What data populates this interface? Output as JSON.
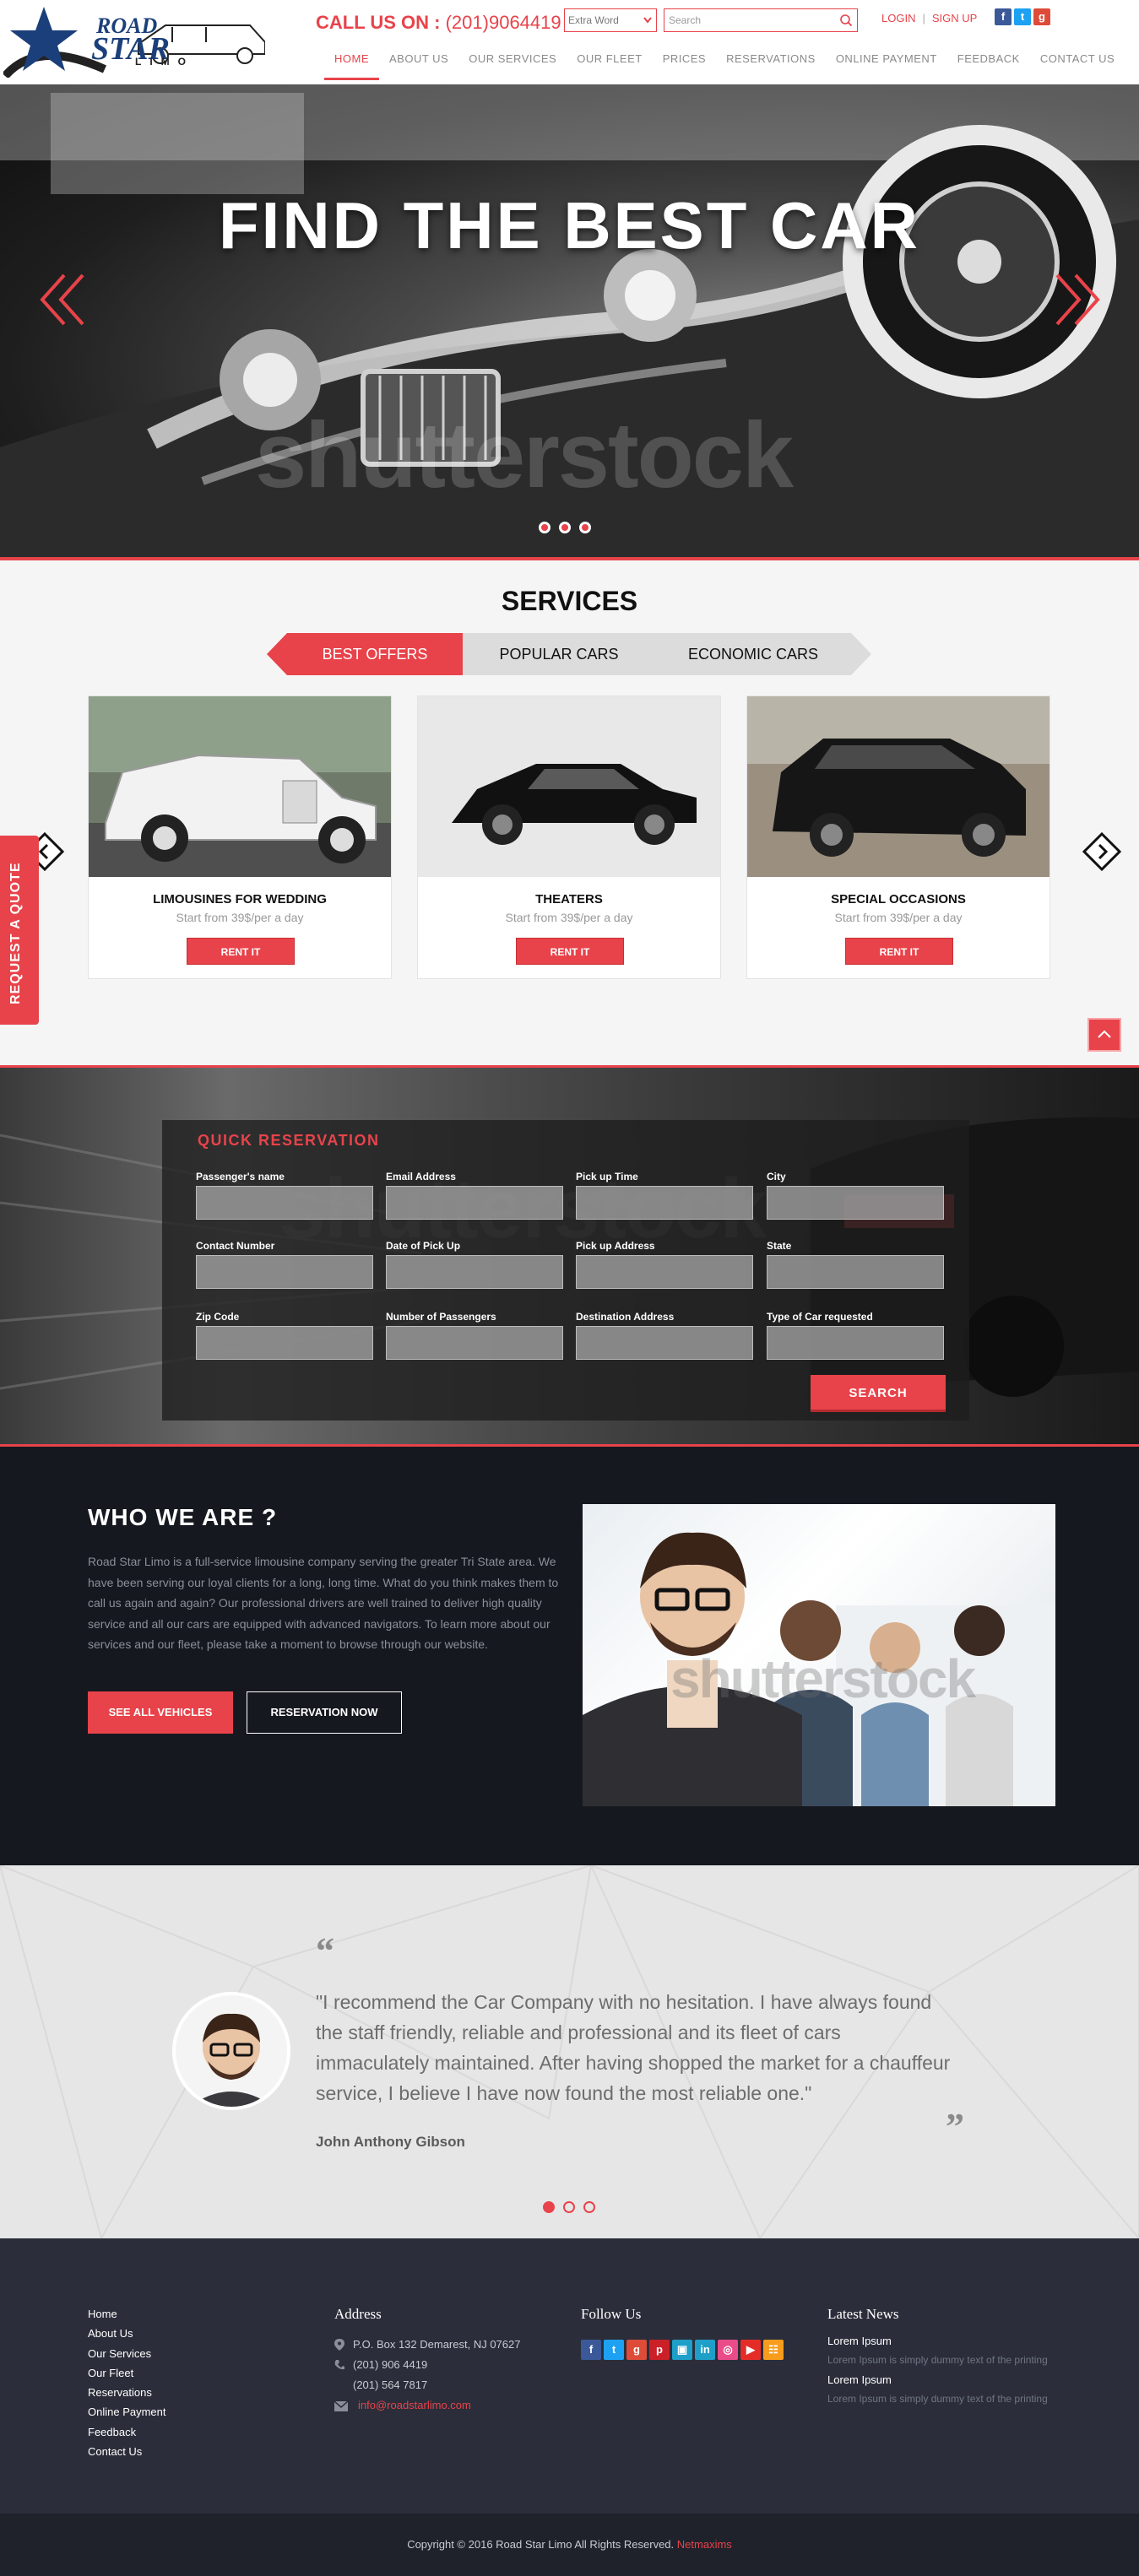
{
  "header": {
    "logo": {
      "word1": "ROAD",
      "word2": "STAR",
      "word3": "LIMO"
    },
    "call_label": "CALL US ON :",
    "phone": "(201)9064419",
    "select_value": "Extra Word",
    "search_placeholder": "Search",
    "login": "LOGIN",
    "signup": "SIGN UP",
    "social": [
      {
        "icon": "facebook-icon",
        "glyph": "f",
        "color": "#3b5998"
      },
      {
        "icon": "twitter-icon",
        "glyph": "t",
        "color": "#1da1f2"
      },
      {
        "icon": "google-plus-icon",
        "glyph": "g",
        "color": "#dd4b39"
      }
    ],
    "nav": [
      "HOME",
      "ABOUT US",
      "OUR SERVICES",
      "OUR FLEET",
      "PRICES",
      "RESERVATIONS",
      "ONLINE PAYMENT",
      "FEEDBACK",
      "CONTACT US"
    ],
    "nav_active_index": 0
  },
  "hero": {
    "title": "FIND THE BEST CAR",
    "watermark": "shutterstock",
    "slides": 3,
    "active_slide": 0
  },
  "services": {
    "title": "SERVICES",
    "tabs": [
      "BEST OFFERS",
      "POPULAR CARS",
      "ECONOMIC CARS"
    ],
    "active_tab": 0,
    "cards": [
      {
        "title": "LIMOUSINES FOR WEDDING",
        "price": "Start from 39$/per a day",
        "button": "RENT IT"
      },
      {
        "title": "THEATERS",
        "price": "Start from 39$/per a day",
        "button": "RENT IT"
      },
      {
        "title": "SPECIAL OCCASIONS",
        "price": "Start from 39$/per a day",
        "button": "RENT IT"
      }
    ],
    "quote_tab": "REQUEST A QUOTE"
  },
  "reservation": {
    "title": "QUICK RESERVATION",
    "fields": [
      "Passenger's name",
      "Email Address",
      "Pick up Time",
      "City",
      "Contact Number",
      "Date of Pick Up",
      "Pick up Address",
      "State",
      "Zip Code",
      "Number of Passengers",
      "Destination Address",
      "Type of Car requested"
    ],
    "button": "SEARCH",
    "watermark": "shutterstock"
  },
  "who": {
    "title": "WHO WE ARE ?",
    "text": "Road Star Limo is a full-service limousine company serving the greater Tri State area. We have been serving our loyal clients for a long, long time. What do you think makes them to call us again and again? Our professional drivers are well trained to deliver high quality service and all our cars are equipped with advanced navigators. To learn more about our services and our fleet, please take a moment to browse through our website.",
    "btn_vehicles": "SEE ALL VEHICLES",
    "btn_reserve": "RESERVATION NOW",
    "watermark": "shutterstock"
  },
  "testimonial": {
    "quote": "\"I recommend the Car Company with no hesitation. I have always found the staff friendly, reliable and professional and its fleet of cars immaculately maintained. After having shopped the market for a chauffeur service, I believe I have now found the most reliable one.\"",
    "name": "John Anthony Gibson",
    "open_mark": "“",
    "close_mark": "”",
    "dots": 3,
    "active_dot": 0
  },
  "footer": {
    "links": [
      "Home",
      "About Us",
      "Our Services",
      "Our Fleet",
      "Reservations",
      "Online Payment",
      "Feedback",
      "Contact Us"
    ],
    "address_title": "Address",
    "address": "P.O. Box 132 Demarest, NJ 07627",
    "phone1": "(201) 906 4419",
    "phone2": "(201) 564 7817",
    "email": "info@roadstarlimo.com",
    "follow_title": "Follow Us",
    "social": [
      {
        "icon": "facebook-icon",
        "glyph": "f",
        "color": "#3b5998"
      },
      {
        "icon": "twitter-icon",
        "glyph": "t",
        "color": "#1da1f2"
      },
      {
        "icon": "google-plus-icon",
        "glyph": "g",
        "color": "#dd4b39"
      },
      {
        "icon": "pinterest-icon",
        "glyph": "p",
        "color": "#cb2027"
      },
      {
        "icon": "flickr-icon",
        "glyph": "▣",
        "color": "#1e9fc8"
      },
      {
        "icon": "linkedin-icon",
        "glyph": "in",
        "color": "#1e9fc8"
      },
      {
        "icon": "dribbble-icon",
        "glyph": "◎",
        "color": "#ea4c89"
      },
      {
        "icon": "youtube-icon",
        "glyph": "▶",
        "color": "#e52d27"
      },
      {
        "icon": "rss-icon",
        "glyph": "☷",
        "color": "#f79c1d"
      }
    ],
    "news_title": "Latest News",
    "news": [
      {
        "title": "Lorem Ipsum",
        "desc": "Lorem Ipsum is simply dummy text of the printing"
      },
      {
        "title": "Lorem Ipsum",
        "desc": "Lorem Ipsum is simply dummy text of the printing"
      }
    ]
  },
  "copyright": {
    "text": "Copyright © 2016 Road Star Limo All Rights Reserved.",
    "brand": "Netmaxims"
  },
  "colors": {
    "accent": "#e8434a",
    "dark": "#15181f",
    "footer": "#2b2e3a",
    "navy": "#1b3f7a"
  }
}
